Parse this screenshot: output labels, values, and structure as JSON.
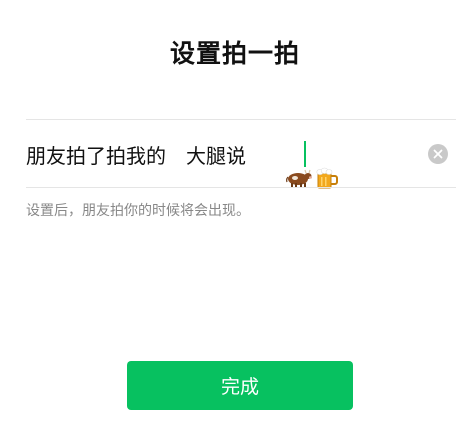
{
  "page": {
    "title": "设置拍一拍"
  },
  "input": {
    "prefix": "朋友拍了拍我的",
    "suffix_text": "大腿说",
    "emojis": [
      "cow-icon",
      "beer-mug-icon"
    ],
    "caret_color": "#07c160"
  },
  "hint": "设置后，朋友拍你的时候将会出现。",
  "actions": {
    "done_label": "完成",
    "accent_color": "#07c160"
  }
}
